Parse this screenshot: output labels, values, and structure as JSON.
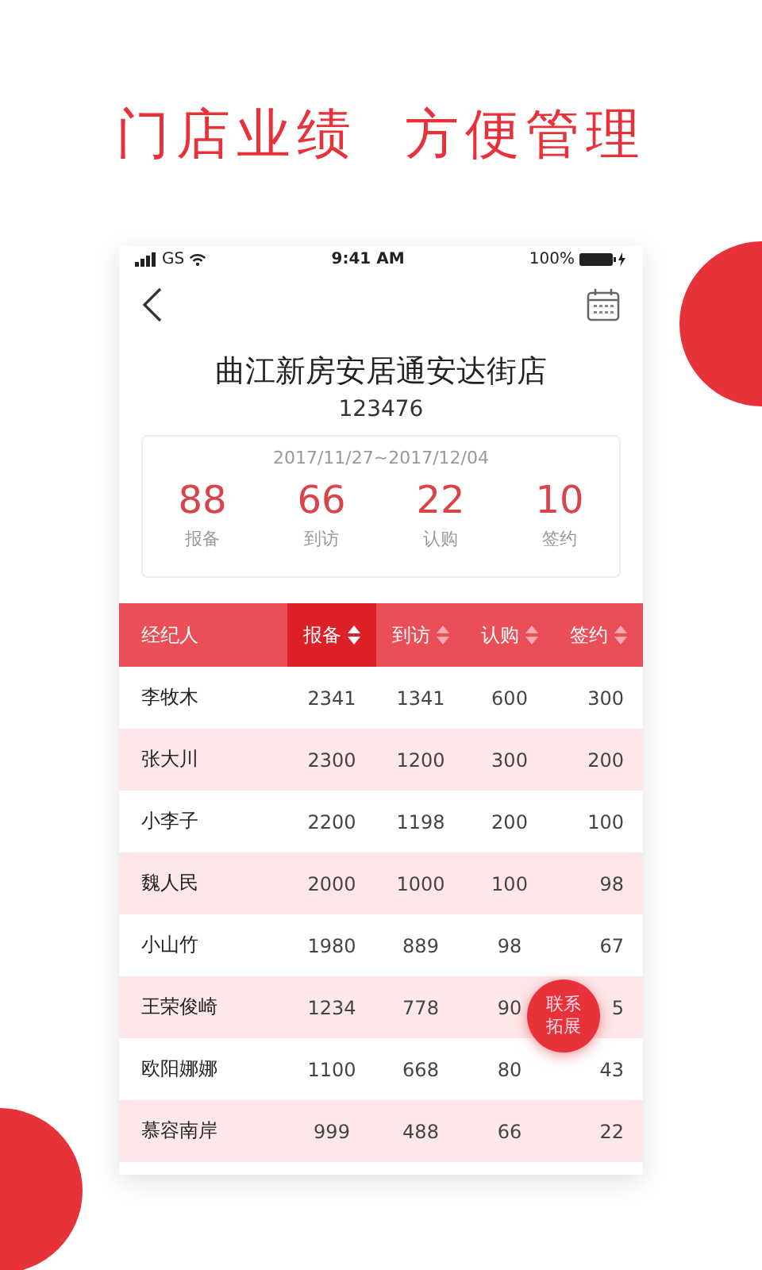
{
  "headline": "门店业绩  方便管理",
  "status_bar": {
    "carrier": "GS",
    "time": "9:41 AM",
    "battery": "100%"
  },
  "store": {
    "name": "曲江新房安居通安达街店",
    "code": "123476"
  },
  "summary": {
    "date_range": "2017/11/27~2017/12/04",
    "stats": [
      {
        "value": "88",
        "label": "报备"
      },
      {
        "value": "66",
        "label": "到访"
      },
      {
        "value": "22",
        "label": "认购"
      },
      {
        "value": "10",
        "label": "签约"
      }
    ]
  },
  "table": {
    "columns": [
      {
        "label": "经纪人",
        "sortable": false,
        "selected": false
      },
      {
        "label": "报备",
        "sortable": true,
        "selected": true
      },
      {
        "label": "到访",
        "sortable": true,
        "selected": false
      },
      {
        "label": "认购",
        "sortable": true,
        "selected": false
      },
      {
        "label": "签约",
        "sortable": true,
        "selected": false
      }
    ],
    "rows": [
      [
        "李牧木",
        "2341",
        "1341",
        "600",
        "300"
      ],
      [
        "张大川",
        "2300",
        "1200",
        "300",
        "200"
      ],
      [
        "小李子",
        "2200",
        "1198",
        "200",
        "100"
      ],
      [
        "魏人民",
        "2000",
        "1000",
        "100",
        "98"
      ],
      [
        "小山竹",
        "1980",
        "889",
        "98",
        "67"
      ],
      [
        "王荣俊崎",
        "1234",
        "778",
        "90",
        "5"
      ],
      [
        "欧阳娜娜",
        "1100",
        "668",
        "80",
        "43"
      ],
      [
        "慕容南岸",
        "999",
        "488",
        "66",
        "22"
      ]
    ]
  },
  "fab": {
    "label": "联系拓展"
  }
}
